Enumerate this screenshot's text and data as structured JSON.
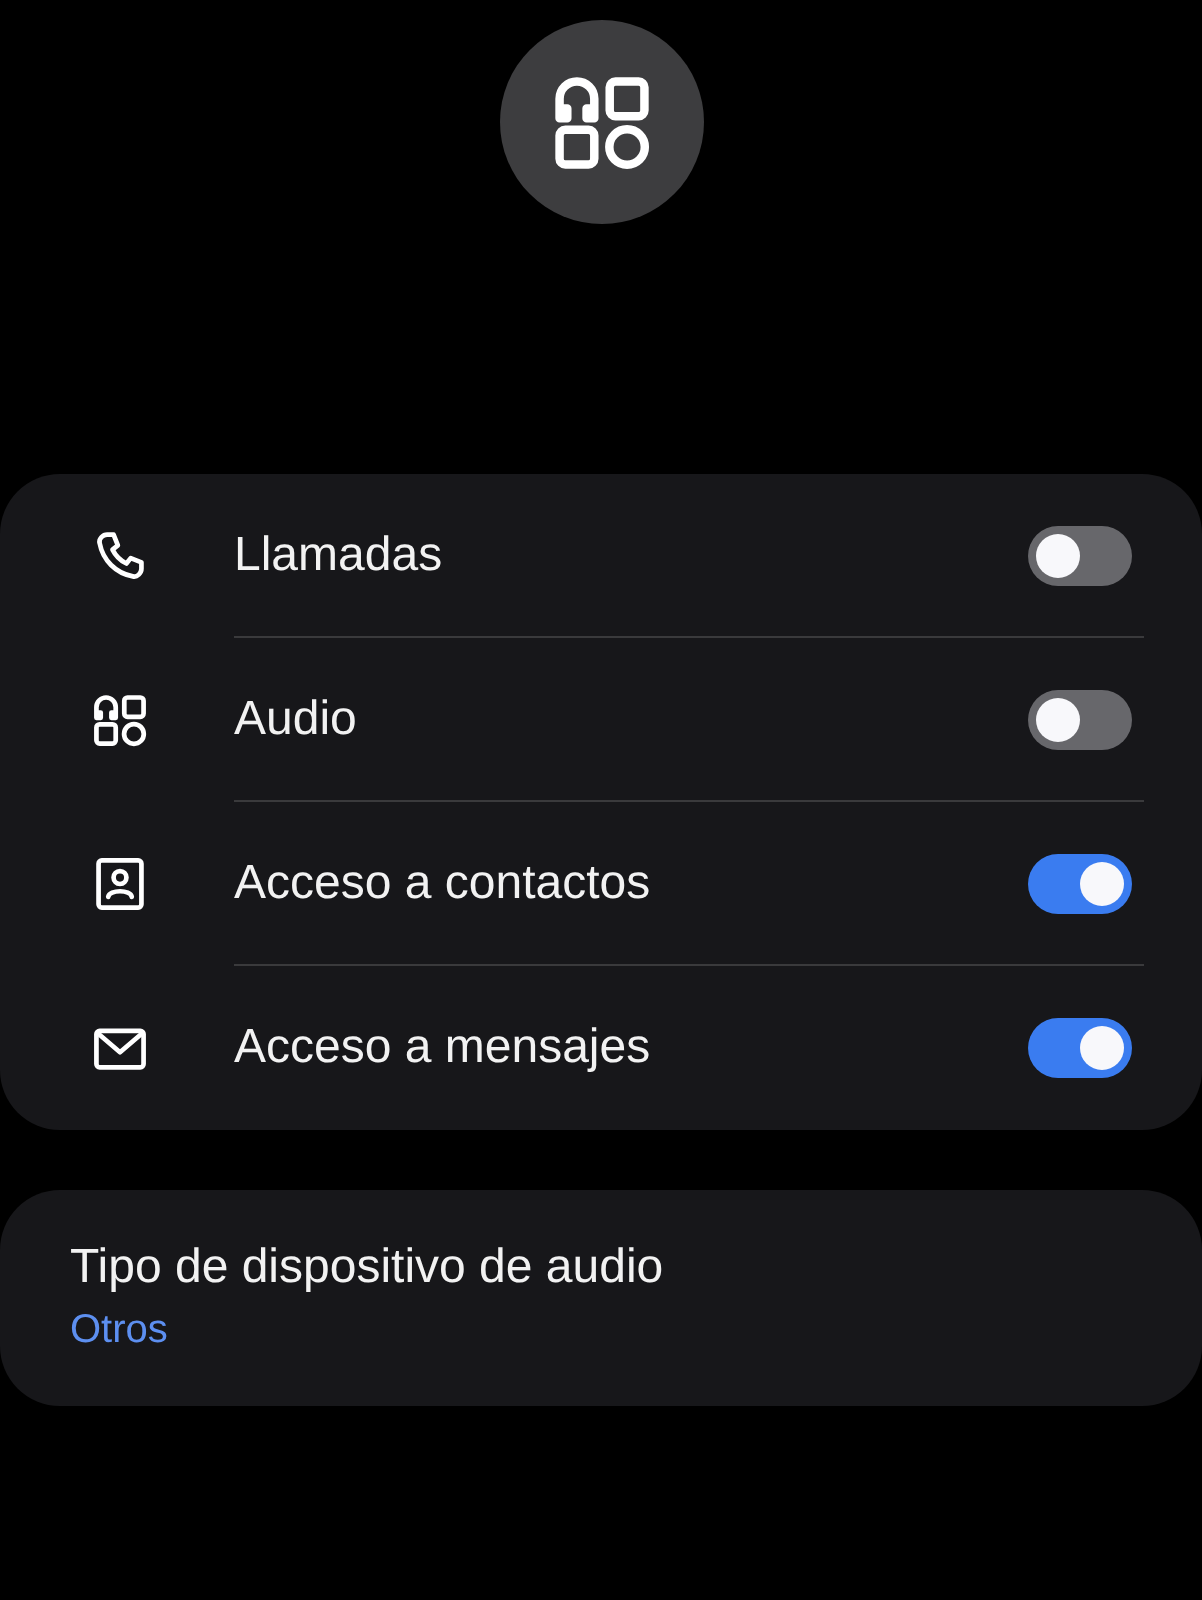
{
  "profiles": [
    {
      "label": "Llamadas",
      "on": false
    },
    {
      "label": "Audio",
      "on": false
    },
    {
      "label": "Acceso a contactos",
      "on": true
    },
    {
      "label": "Acceso a mensajes",
      "on": true
    }
  ],
  "device_type": {
    "title": "Tipo de dispositivo de audio",
    "value": "Otros"
  }
}
